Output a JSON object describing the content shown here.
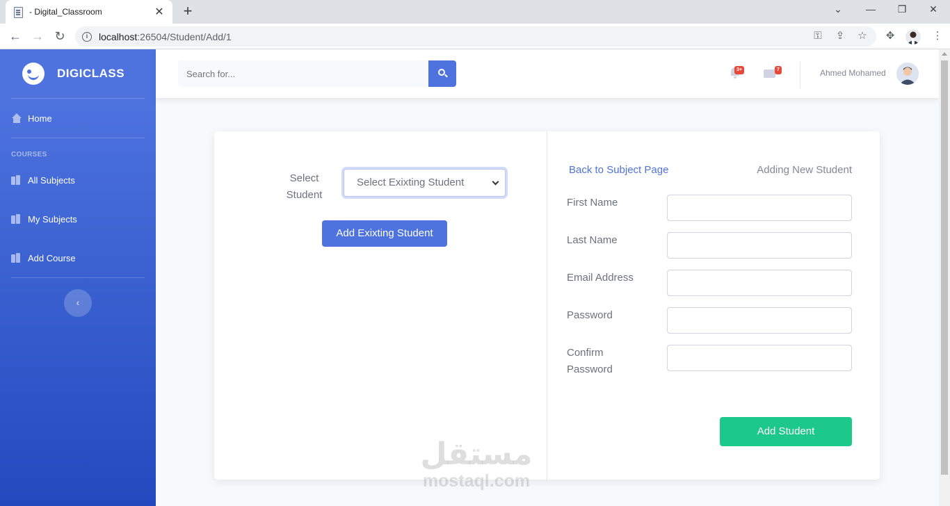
{
  "browser": {
    "tab_title": "- Digital_Classroom",
    "url_host": "localhost",
    "url_path": ":26504/Student/Add/1"
  },
  "sidebar": {
    "brand": "DIGICLASS",
    "home_label": "Home",
    "section_heading": "COURSES",
    "items": [
      {
        "label": "All Subjects"
      },
      {
        "label": "My Subjects"
      },
      {
        "label": "Add Course"
      }
    ],
    "toggle_glyph": "‹"
  },
  "topbar": {
    "search_placeholder": "Search for...",
    "alerts_badge": "3+",
    "messages_badge": "7",
    "user_name": "Ahmed Mohamed"
  },
  "existing": {
    "select_label": "Select Student",
    "select_value": "Select Exixting Student",
    "add_button": "Add Exixting Student"
  },
  "new_student": {
    "back_link": "Back to Subject Page",
    "title": "Adding New Student",
    "fields": [
      {
        "label": "First Name",
        "value": ""
      },
      {
        "label": "Last Name",
        "value": ""
      },
      {
        "label": "Email Address",
        "value": ""
      },
      {
        "label": "Password",
        "value": ""
      },
      {
        "label": "Confirm Password",
        "value": ""
      }
    ],
    "submit": "Add Student"
  },
  "watermark": {
    "arabic": "مستقل",
    "latin": "mostaql.com"
  },
  "colors": {
    "primary": "#4e73df",
    "success": "#1cc88a",
    "danger": "#e74a3b"
  }
}
